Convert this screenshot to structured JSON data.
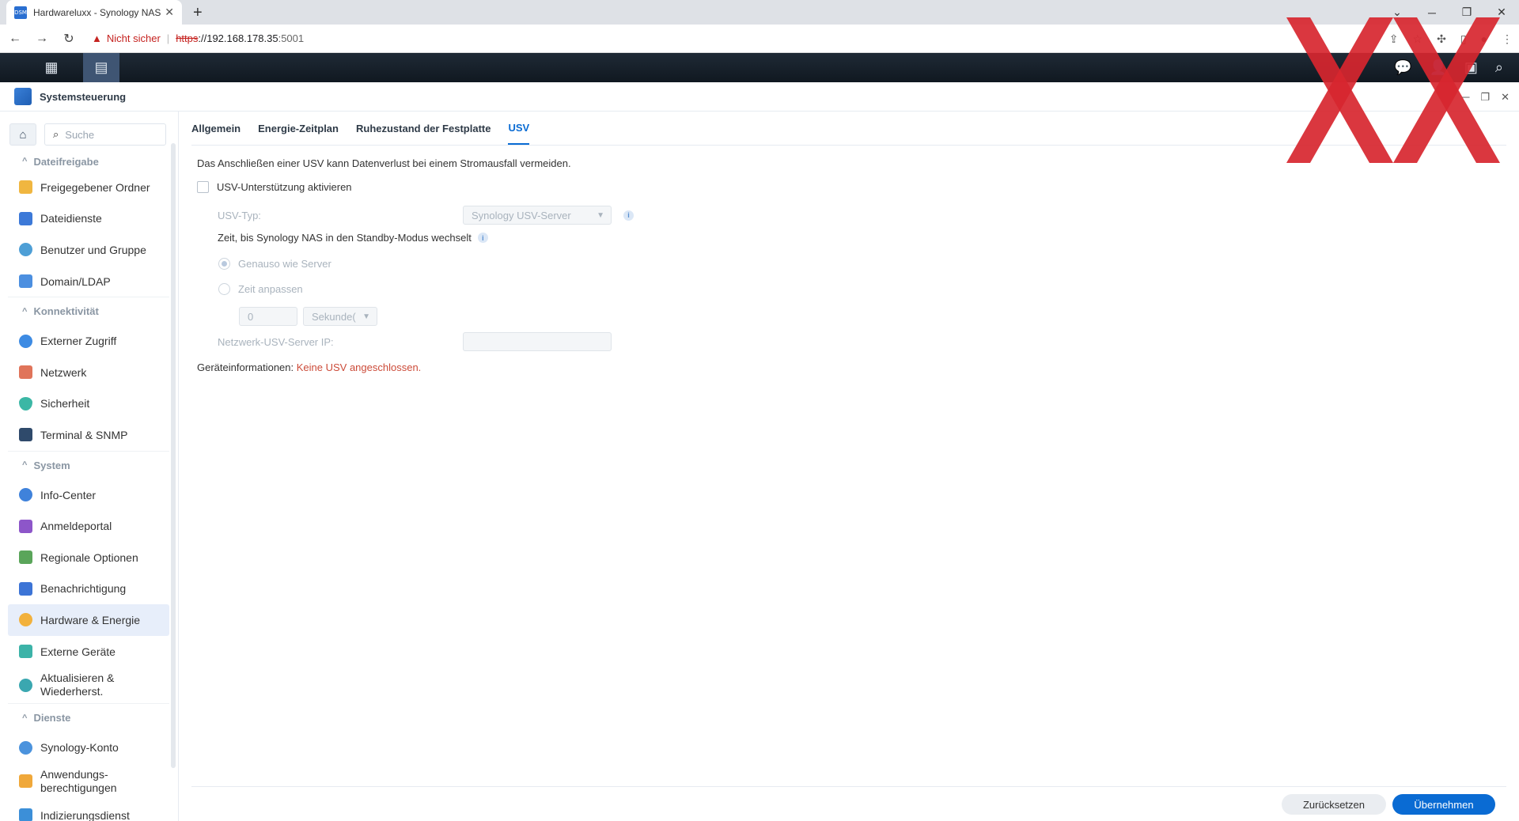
{
  "browser": {
    "tab_title": "Hardwareluxx - Synology NAS",
    "favicon_text": "DSM",
    "tab_close": "✕",
    "new_tab": "+",
    "not_secure": "Nicht sicher",
    "url_scheme": "https",
    "url_host": "://192.168.178.35",
    "url_port": ":5001"
  },
  "window": {
    "title": "Systemsteuerung"
  },
  "sidebar": {
    "search_placeholder": "Suche",
    "sections": [
      {
        "title": "Dateifreigabe",
        "items": [
          "Freigegebener Ordner",
          "Dateidienste",
          "Benutzer und Gruppe",
          "Domain/LDAP"
        ]
      },
      {
        "title": "Konnektivität",
        "items": [
          "Externer Zugriff",
          "Netzwerk",
          "Sicherheit",
          "Terminal & SNMP"
        ]
      },
      {
        "title": "System",
        "items": [
          "Info-Center",
          "Anmeldeportal",
          "Regionale Optionen",
          "Benachrichtigung",
          "Hardware & Energie",
          "Externe Geräte"
        ],
        "tall_item_line1": "Aktualisieren &",
        "tall_item_line2": "Wiederherst."
      },
      {
        "title": "Dienste",
        "items": [
          "Synology-Konto"
        ],
        "tall_item_line1": "Anwendungs-",
        "tall_item_line2": "berechtigungen",
        "cut_item": "Indizierungsdienst"
      }
    ]
  },
  "tabs": [
    "Allgemein",
    "Energie-Zeitplan",
    "Ruhezustand der Festplatte",
    "USV"
  ],
  "ups": {
    "description": "Das Anschließen einer USV kann Datenverlust bei einem Stromausfall vermeiden.",
    "enable_label": "USV-Unterstützung aktivieren",
    "type_label": "USV-Typ:",
    "type_value": "Synology USV-Server",
    "standby_label": "Zeit, bis Synology NAS in den Standby-Modus wechselt",
    "radio_same": "Genauso wie Server",
    "radio_custom": "Zeit anpassen",
    "time_value": "0",
    "time_unit": "Sekunde(",
    "server_ip_label": "Netzwerk-USV-Server IP:",
    "device_info_label": "Geräteinformationen:",
    "device_info_value": "Keine USV angeschlossen."
  },
  "footer": {
    "reset": "Zurücksetzen",
    "apply": "Übernehmen"
  },
  "colors": {
    "accent": "#0a6bd3",
    "error": "#cc4b39",
    "logo_red": "#d7262f"
  }
}
